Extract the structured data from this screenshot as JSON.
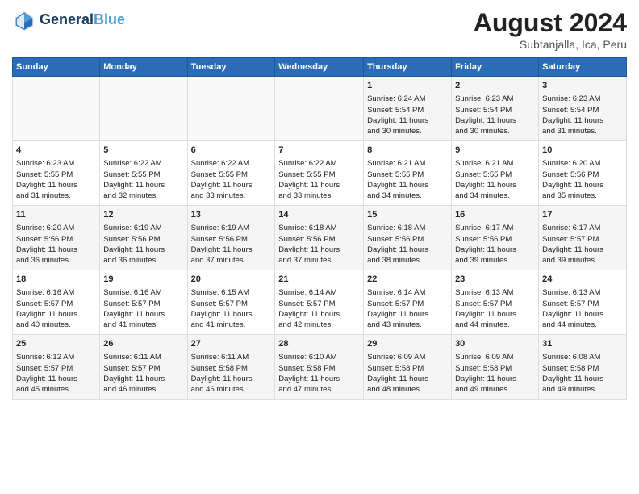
{
  "header": {
    "logo_line1": "General",
    "logo_line2": "Blue",
    "main_title": "August 2024",
    "subtitle": "Subtanjalla, Ica, Peru"
  },
  "days_of_week": [
    "Sunday",
    "Monday",
    "Tuesday",
    "Wednesday",
    "Thursday",
    "Friday",
    "Saturday"
  ],
  "weeks": [
    {
      "days": [
        {
          "num": "",
          "content": ""
        },
        {
          "num": "",
          "content": ""
        },
        {
          "num": "",
          "content": ""
        },
        {
          "num": "",
          "content": ""
        },
        {
          "num": "1",
          "content": "Sunrise: 6:24 AM\nSunset: 5:54 PM\nDaylight: 11 hours\nand 30 minutes."
        },
        {
          "num": "2",
          "content": "Sunrise: 6:23 AM\nSunset: 5:54 PM\nDaylight: 11 hours\nand 30 minutes."
        },
        {
          "num": "3",
          "content": "Sunrise: 6:23 AM\nSunset: 5:54 PM\nDaylight: 11 hours\nand 31 minutes."
        }
      ]
    },
    {
      "days": [
        {
          "num": "4",
          "content": "Sunrise: 6:23 AM\nSunset: 5:55 PM\nDaylight: 11 hours\nand 31 minutes."
        },
        {
          "num": "5",
          "content": "Sunrise: 6:22 AM\nSunset: 5:55 PM\nDaylight: 11 hours\nand 32 minutes."
        },
        {
          "num": "6",
          "content": "Sunrise: 6:22 AM\nSunset: 5:55 PM\nDaylight: 11 hours\nand 33 minutes."
        },
        {
          "num": "7",
          "content": "Sunrise: 6:22 AM\nSunset: 5:55 PM\nDaylight: 11 hours\nand 33 minutes."
        },
        {
          "num": "8",
          "content": "Sunrise: 6:21 AM\nSunset: 5:55 PM\nDaylight: 11 hours\nand 34 minutes."
        },
        {
          "num": "9",
          "content": "Sunrise: 6:21 AM\nSunset: 5:55 PM\nDaylight: 11 hours\nand 34 minutes."
        },
        {
          "num": "10",
          "content": "Sunrise: 6:20 AM\nSunset: 5:56 PM\nDaylight: 11 hours\nand 35 minutes."
        }
      ]
    },
    {
      "days": [
        {
          "num": "11",
          "content": "Sunrise: 6:20 AM\nSunset: 5:56 PM\nDaylight: 11 hours\nand 36 minutes."
        },
        {
          "num": "12",
          "content": "Sunrise: 6:19 AM\nSunset: 5:56 PM\nDaylight: 11 hours\nand 36 minutes."
        },
        {
          "num": "13",
          "content": "Sunrise: 6:19 AM\nSunset: 5:56 PM\nDaylight: 11 hours\nand 37 minutes."
        },
        {
          "num": "14",
          "content": "Sunrise: 6:18 AM\nSunset: 5:56 PM\nDaylight: 11 hours\nand 37 minutes."
        },
        {
          "num": "15",
          "content": "Sunrise: 6:18 AM\nSunset: 5:56 PM\nDaylight: 11 hours\nand 38 minutes."
        },
        {
          "num": "16",
          "content": "Sunrise: 6:17 AM\nSunset: 5:56 PM\nDaylight: 11 hours\nand 39 minutes."
        },
        {
          "num": "17",
          "content": "Sunrise: 6:17 AM\nSunset: 5:57 PM\nDaylight: 11 hours\nand 39 minutes."
        }
      ]
    },
    {
      "days": [
        {
          "num": "18",
          "content": "Sunrise: 6:16 AM\nSunset: 5:57 PM\nDaylight: 11 hours\nand 40 minutes."
        },
        {
          "num": "19",
          "content": "Sunrise: 6:16 AM\nSunset: 5:57 PM\nDaylight: 11 hours\nand 41 minutes."
        },
        {
          "num": "20",
          "content": "Sunrise: 6:15 AM\nSunset: 5:57 PM\nDaylight: 11 hours\nand 41 minutes."
        },
        {
          "num": "21",
          "content": "Sunrise: 6:14 AM\nSunset: 5:57 PM\nDaylight: 11 hours\nand 42 minutes."
        },
        {
          "num": "22",
          "content": "Sunrise: 6:14 AM\nSunset: 5:57 PM\nDaylight: 11 hours\nand 43 minutes."
        },
        {
          "num": "23",
          "content": "Sunrise: 6:13 AM\nSunset: 5:57 PM\nDaylight: 11 hours\nand 44 minutes."
        },
        {
          "num": "24",
          "content": "Sunrise: 6:13 AM\nSunset: 5:57 PM\nDaylight: 11 hours\nand 44 minutes."
        }
      ]
    },
    {
      "days": [
        {
          "num": "25",
          "content": "Sunrise: 6:12 AM\nSunset: 5:57 PM\nDaylight: 11 hours\nand 45 minutes."
        },
        {
          "num": "26",
          "content": "Sunrise: 6:11 AM\nSunset: 5:57 PM\nDaylight: 11 hours\nand 46 minutes."
        },
        {
          "num": "27",
          "content": "Sunrise: 6:11 AM\nSunset: 5:58 PM\nDaylight: 11 hours\nand 46 minutes."
        },
        {
          "num": "28",
          "content": "Sunrise: 6:10 AM\nSunset: 5:58 PM\nDaylight: 11 hours\nand 47 minutes."
        },
        {
          "num": "29",
          "content": "Sunrise: 6:09 AM\nSunset: 5:58 PM\nDaylight: 11 hours\nand 48 minutes."
        },
        {
          "num": "30",
          "content": "Sunrise: 6:09 AM\nSunset: 5:58 PM\nDaylight: 11 hours\nand 49 minutes."
        },
        {
          "num": "31",
          "content": "Sunrise: 6:08 AM\nSunset: 5:58 PM\nDaylight: 11 hours\nand 49 minutes."
        }
      ]
    }
  ]
}
